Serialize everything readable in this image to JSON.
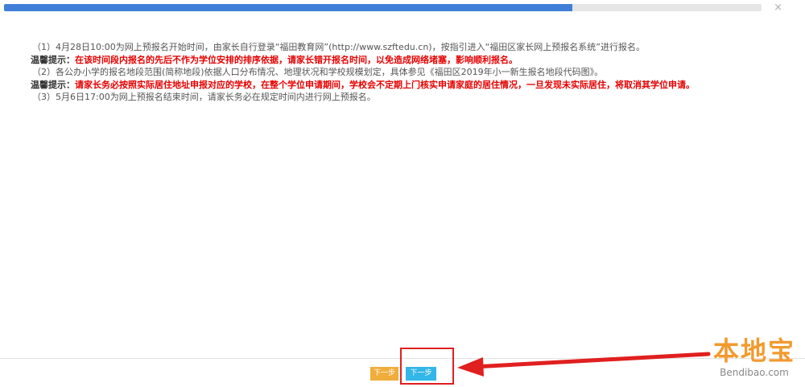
{
  "progress": {
    "percent": 75
  },
  "close_glyph": "×",
  "instructions": {
    "step1": "（1）4月28日10:00为网上预报名开始时间，由家长自行登录“福田教育网”(http://www.szftedu.cn)，按指引进入“福田区家长网上预报名系统”进行报名。",
    "tip1_label": "温馨提示：",
    "tip1_text": "在该时间段内报名的先后不作为学位安排的排序依据，请家长错开报名时间，以免造成网络堵塞，影响顺利报名。",
    "step2": "（2）各公办小学的报名地段范围(简称地段)依据人口分布情况、地理状况和学校规模划定，具体参见《福田区2019年小一新生报名地段代码图》。",
    "tip2_label": "温馨提示：",
    "tip2_text": "请家长务必按照实际居住地址申报对应的学校，在整个学位申请期间，学校会不定期上门核实申请家庭的居住情况，一旦发现未实际居住，将取消其学位申请。",
    "step3": "（3）5月6日17:00为网上预报名结束时间，请家长务必在规定时间内进行网上预报名。"
  },
  "footer": {
    "prev_label": "下一步",
    "next_label": "下一步"
  },
  "watermark": {
    "logo": "本地宝",
    "url": "Bendibao.com"
  },
  "colors": {
    "progress_fill": "#3f7fd8",
    "warning_text": "#e60000",
    "prev_button": "#f0ad3c",
    "next_button": "#33b6e8",
    "annotation": "#e0201f",
    "watermark": "#f29a2e"
  }
}
